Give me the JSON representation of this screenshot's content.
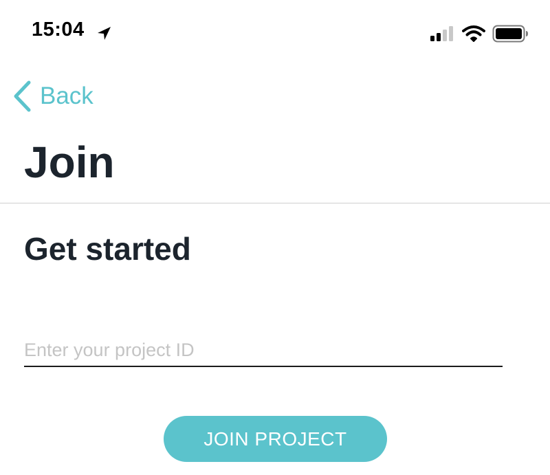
{
  "status_bar": {
    "time": "15:04",
    "icons": [
      "location-arrow-icon",
      "cellular-signal-icon",
      "wifi-icon",
      "battery-icon"
    ]
  },
  "nav": {
    "back_label": "Back",
    "back_icon": "chevron-left-icon"
  },
  "page": {
    "title": "Join"
  },
  "form": {
    "section_title": "Get started",
    "project_id": {
      "value": "",
      "placeholder": "Enter your project ID"
    },
    "submit_label": "JOIN PROJECT"
  },
  "colors": {
    "accent": "#5bc3cc",
    "text_dark": "#1c242d",
    "placeholder": "#c4c4c4",
    "divider": "#cfcfcf"
  }
}
